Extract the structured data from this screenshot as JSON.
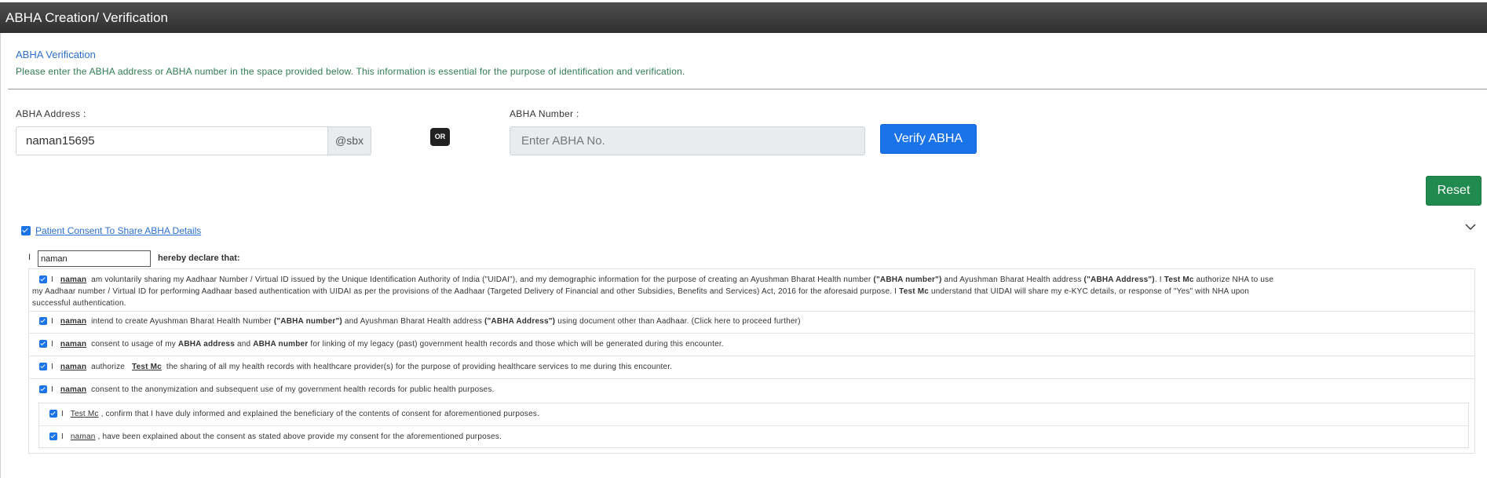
{
  "window": {
    "title": "ABHA Creation/ Verification"
  },
  "verification": {
    "title": "ABHA Verification",
    "description": "Please enter the ABHA address or ABHA number in the space provided below. This information is essential for the purpose of identification and verification."
  },
  "form": {
    "address_label": "ABHA Address :",
    "address_value": "naman15695",
    "address_suffix": "@sbx",
    "or_label": "OR",
    "number_label": "ABHA Number :",
    "number_placeholder": "Enter ABHA No.",
    "verify_button": "Verify ABHA",
    "reset_button": "Reset"
  },
  "consent": {
    "checked": true,
    "link_label": "Patient Consent To Share ABHA Details",
    "i_label": "I",
    "name_value": "naman",
    "declare_text": "hereby declare that:",
    "patient_name": "naman",
    "provider_name": "Test Mc",
    "items": [
      {
        "t1": "am voluntarily sharing my Aadhaar Number / Virtual ID issued by the Unique Identification Authority of India (\"UIDAI\"), and my demographic information for the purpose of creating an Ayushman Bharat Health number ",
        "b1": "(\"ABHA number\")",
        "t2": " and Ayushman Bharat Health address ",
        "b2": "(\"ABHA Address\")",
        "t3": ". I ",
        "t4": " authorize NHA to use",
        "line2": "my Aadhaar number / Virtual ID for performing Aadhaar based authentication with UIDAI as per the provisions of the Aadhaar (Targeted Delivery of Financial and other Subsidies, Benefits and Services) Act, 2016 for the aforesaid purpose. I ",
        "line2b": " understand that UIDAI will share my e-KYC details, or response of \"Yes\" with NHA upon",
        "line3": "successful authentication."
      },
      {
        "t1": "intend to create Ayushman Bharat Health Number ",
        "b1": "(\"ABHA number\")",
        "t2": " and Ayushman Bharat Health address ",
        "b2": "(\"ABHA Address\")",
        "t3": " using document other than Aadhaar. (Click here to proceed further)"
      },
      {
        "t1": "consent to usage of my ",
        "b1": "ABHA address",
        "t2": " and ",
        "b2": "ABHA number",
        "t3": " for linking of my legacy (past) government health records and those which will be generated during this encounter."
      },
      {
        "t1": "authorize",
        "t2": "the sharing of all my health records with healthcare provider(s) for the purpose of providing healthcare services to me during this encounter."
      },
      {
        "t1": "consent to the anonymization and subsequent use of my government health records for public health purposes."
      }
    ],
    "sub_items": [
      {
        "t1": ", confirm that I have duly informed and explained the beneficiary of the contents of consent for aforementioned purposes."
      },
      {
        "t1": ", have been explained about the consent as stated above provide my consent for the aforementioned purposes."
      }
    ]
  },
  "icons": {
    "chevron": "chevron-down-icon",
    "check": "checkbox-checked-icon"
  },
  "colors": {
    "primary": "#1a73e8",
    "success": "#218a4f",
    "header": "#3a3a3a",
    "desc": "#2e7d4f",
    "link": "#2a6fcf"
  }
}
